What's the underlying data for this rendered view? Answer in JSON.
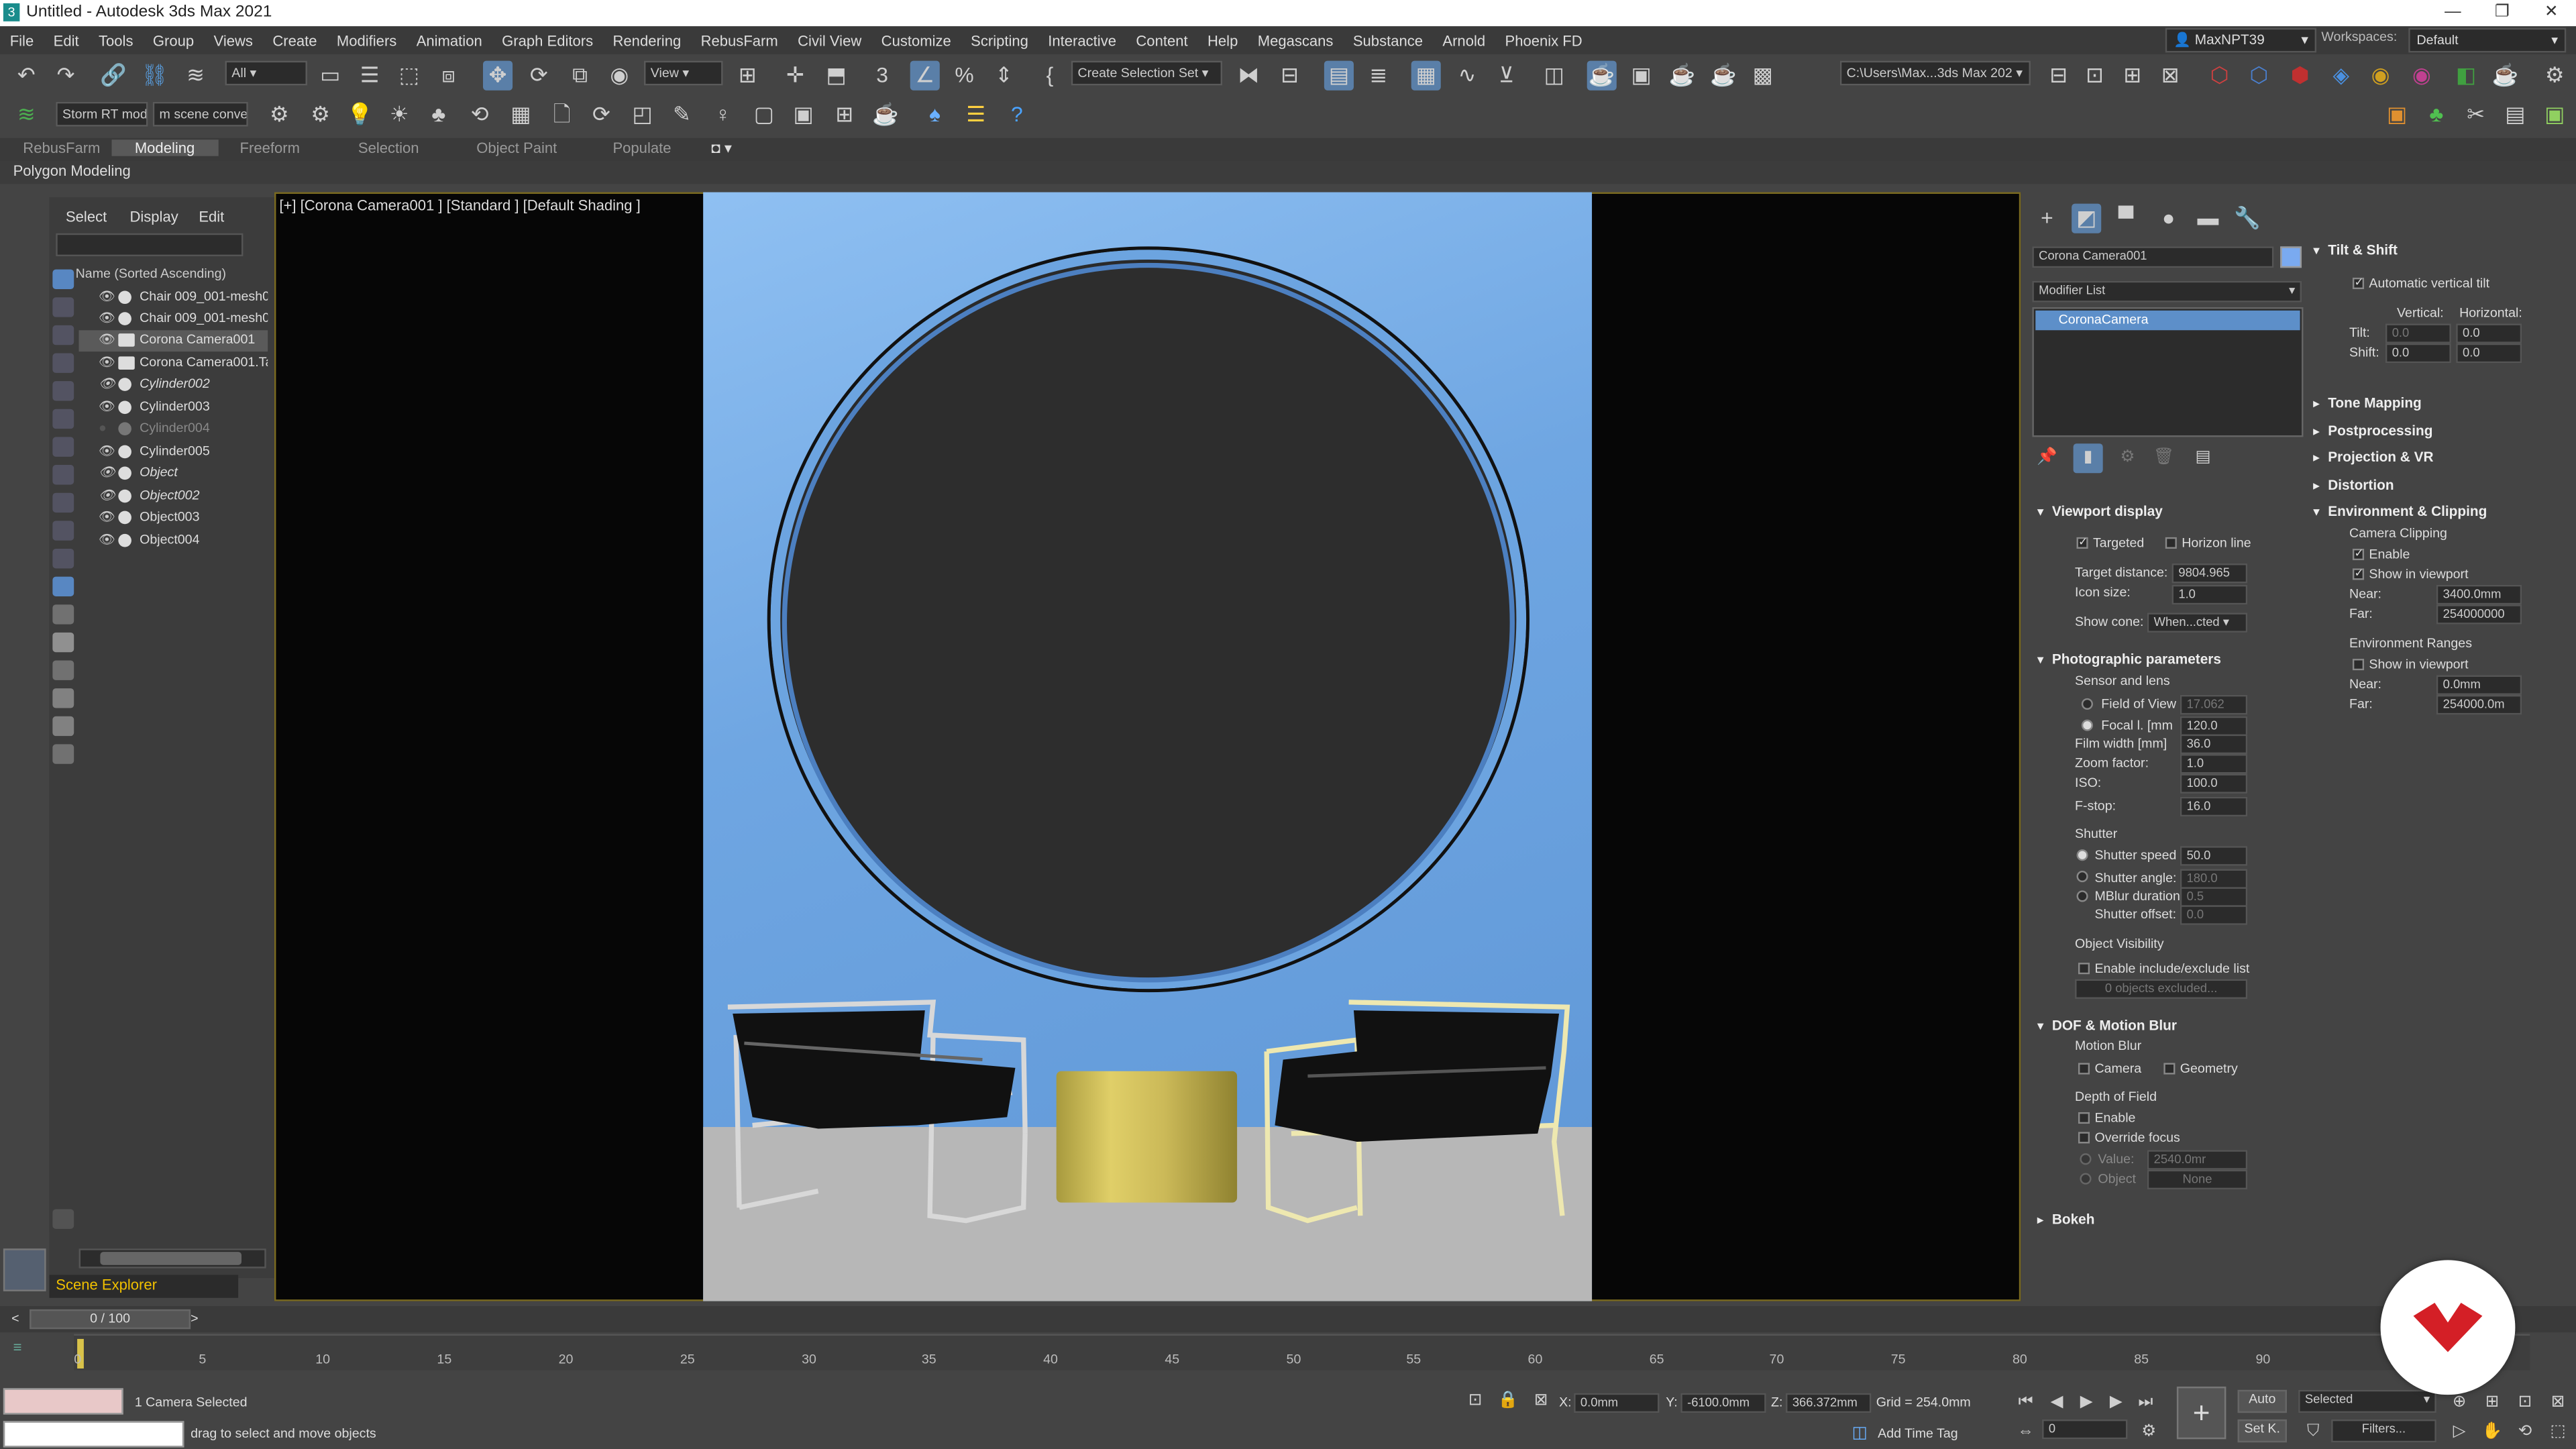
{
  "window": {
    "title": "Untitled - Autodesk 3ds Max 2021"
  },
  "menu": [
    "File",
    "Edit",
    "Tools",
    "Group",
    "Views",
    "Create",
    "Modifiers",
    "Animation",
    "Graph Editors",
    "Rendering",
    "RebusFarm",
    "Civil View",
    "Customize",
    "Scripting",
    "Interactive",
    "Content",
    "Help",
    "Megascans",
    "Substance",
    "Arnold",
    "Phoenix FD"
  ],
  "user": {
    "name": "MaxNPT39",
    "workspaces_label": "Workspaces:",
    "workspace": "Default"
  },
  "toolbar": {
    "filter": "All",
    "ref_coord": "View",
    "selection_set": "Create Selection Set",
    "path": "C:\\Users\\Max...3ds Max 202",
    "storm": "Storm RT mod",
    "scene_conv": "m scene conve"
  },
  "ribbon": {
    "tabs": [
      "RebusFarm",
      "Modeling",
      "Freeform",
      "Selection",
      "Object Paint",
      "Populate"
    ],
    "active": "Modeling",
    "subbar": "Polygon Modeling"
  },
  "explorer": {
    "tabs": [
      "Select",
      "Display",
      "Edit"
    ],
    "header": "Name (Sorted Ascending)",
    "items": [
      {
        "name": "Chair 009_001-mesh0"
      },
      {
        "name": "Chair 009_001-mesh0"
      },
      {
        "name": "Corona Camera001"
      },
      {
        "name": "Corona Camera001.Ta"
      },
      {
        "name": "Cylinder002"
      },
      {
        "name": "Cylinder003"
      },
      {
        "name": "Cylinder004"
      },
      {
        "name": "Cylinder005"
      },
      {
        "name": "Object"
      },
      {
        "name": "Object002"
      },
      {
        "name": "Object003"
      },
      {
        "name": "Object004"
      }
    ],
    "footer": "Scene Explorer"
  },
  "viewport": {
    "label": "[+] [Corona Camera001 ] [Standard ] [Default Shading ]"
  },
  "command": {
    "object_name": "Corona Camera001",
    "modifier_list": "Modifier List",
    "stack_item": "CoronaCamera",
    "viewport_display": {
      "title": "Viewport display",
      "targeted": "Targeted",
      "horizon": "Horizon line",
      "target_distance_label": "Target distance:",
      "target_distance": "9804.965",
      "icon_size_label": "Icon size:",
      "icon_size": "1.0",
      "show_cone_label": "Show cone:",
      "show_cone": "When...cted"
    },
    "photo": {
      "title": "Photographic parameters",
      "sensor": "Sensor and lens",
      "fov_label": "Field of View",
      "fov": "17.062",
      "focal_label": "Focal l. [mm",
      "focal": "120.0",
      "film_label": "Film width [mm]",
      "film": "36.0",
      "zoom_label": "Zoom factor:",
      "zoom": "1.0",
      "iso_label": "ISO:",
      "iso": "100.0",
      "fstop_label": "F-stop:",
      "fstop": "16.0",
      "shutter": "Shutter",
      "speed_label": "Shutter speed",
      "speed": "50.0",
      "angle_label": "Shutter angle:",
      "angle": "180.0",
      "mblur_label": "MBlur duration:",
      "mblur": "0.5",
      "offset_label": "Shutter offset:",
      "offset": "0.0",
      "objvis": "Object Visibility",
      "include": "Enable include/exclude list",
      "excluded": "0 objects excluded..."
    },
    "dof": {
      "title": "DOF & Motion Blur",
      "motion": "Motion Blur",
      "camera": "Camera",
      "geometry": "Geometry",
      "depth": "Depth of Field",
      "enable": "Enable",
      "override": "Override focus",
      "value_label": "Value:",
      "value": "2540.0mr",
      "object_label": "Object",
      "object": "None"
    },
    "bokeh": "Bokeh"
  },
  "right": {
    "tilt": {
      "title": "Tilt & Shift",
      "auto": "Automatic vertical tilt",
      "vertical": "Vertical:",
      "horizontal": "Horizontal:",
      "tilt_label": "Tilt:",
      "shift_label": "Shift:",
      "v_tilt": "0.0",
      "h_tilt": "0.0",
      "v_shift": "0.0",
      "h_shift": "0.0"
    },
    "sections": [
      "Tone Mapping",
      "Postprocessing",
      "Projection & VR",
      "Distortion"
    ],
    "env": {
      "title": "Environment & Clipping",
      "clip": "Camera Clipping",
      "enable": "Enable",
      "show": "Show in viewport",
      "near_label": "Near:",
      "near": "3400.0mm",
      "far_label": "Far:",
      "far": "254000000",
      "ranges": "Environment Ranges",
      "show2": "Show in viewport",
      "near2": "0.0mm",
      "far2": "254000.0m"
    }
  },
  "timeline": {
    "frame": "0 / 100",
    "ticks": [
      "0",
      "5",
      "10",
      "15",
      "20",
      "25",
      "30",
      "35",
      "40",
      "45",
      "50",
      "55",
      "60",
      "65",
      "70",
      "75",
      "80",
      "85",
      "90"
    ]
  },
  "statusbar": {
    "selected": "1 Camera Selected",
    "hint": "drag to select and move objects",
    "x_label": "X:",
    "x": "0.0mm",
    "y_label": "Y:",
    "y": "-6100.0mm",
    "z_label": "Z:",
    "z": "366.372mm",
    "grid": "Grid = 254.0mm",
    "time_tag": "Add Time Tag",
    "auto": "Auto",
    "selected_dd": "Selected",
    "setk": "Set K.",
    "filters": "Filters...",
    "frame_field": "0"
  }
}
